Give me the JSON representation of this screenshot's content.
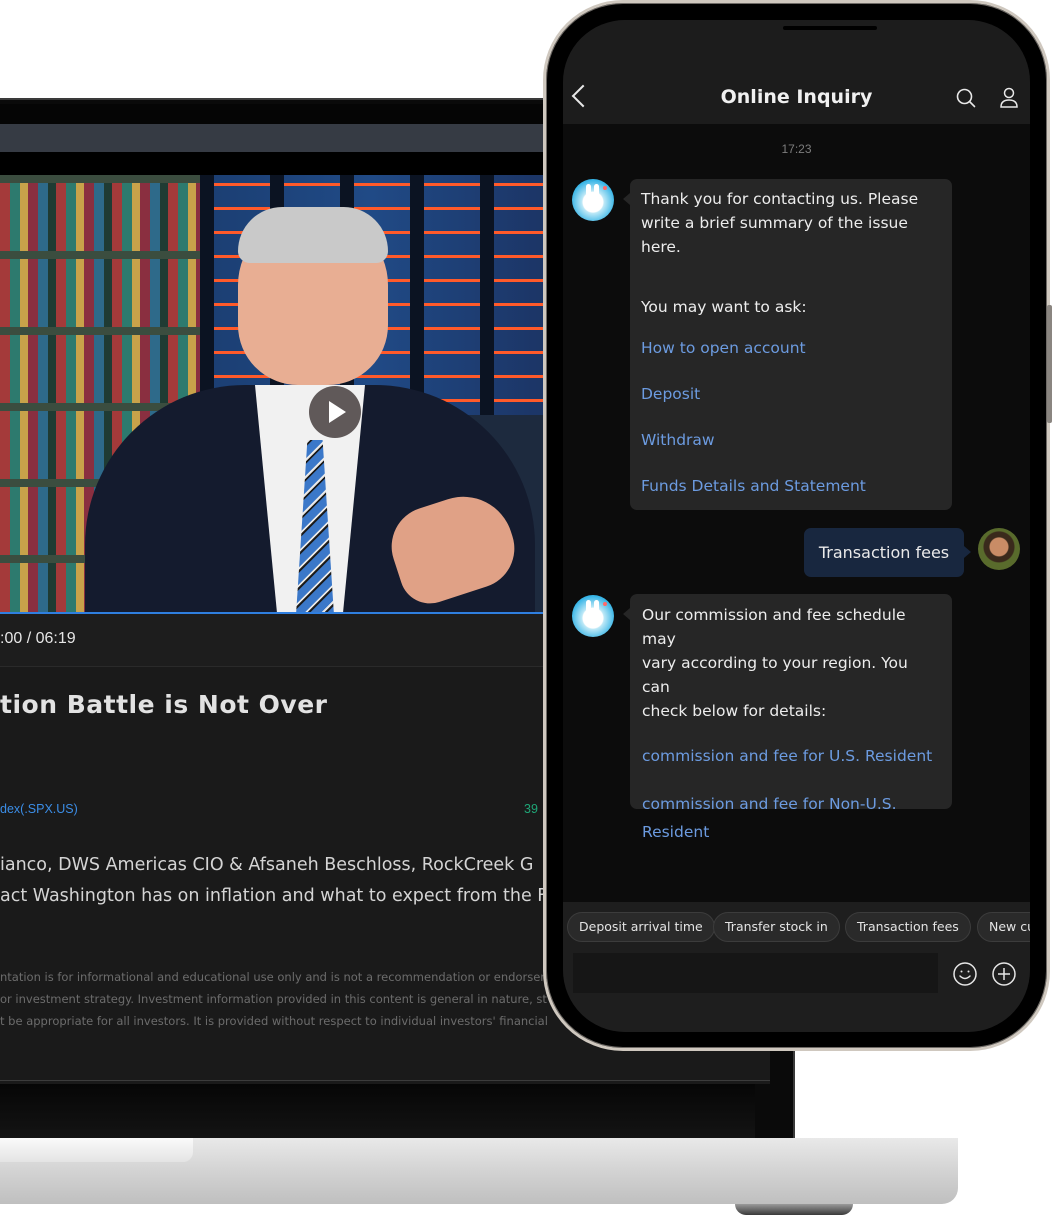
{
  "laptop": {
    "video": {
      "time_display": ":00 / 06:19",
      "play_icon": "play-icon",
      "progress_fraction": 1.0
    },
    "title": "tion Battle is Not Over",
    "ticker_label": "dex(.SPX.US)",
    "ticker_value": "39",
    "description_lines": [
      "ianco, DWS Americas CIO & Afsaneh Beschloss, RockCreek G",
      "act Washington has on inflation and what to expect from the F"
    ],
    "disclaimer_lines": [
      "ntation is for informational and educational use only and is not a recommendation or endorsem",
      " or investment strategy. Investment information provided in this content is general in nature, st",
      "t be appropriate for all investors. It is provided without respect to individual investors' financial"
    ]
  },
  "phone": {
    "header": {
      "title": "Online Inquiry",
      "back_icon": "chevron-left-icon",
      "search_icon": "search-icon",
      "user_icon": "user-icon"
    },
    "timestamp": "17:23",
    "messages": [
      {
        "sender": "bot",
        "text_lines": [
          "Thank you for contacting us. Please",
          "write a brief summary of the issue",
          "here."
        ],
        "prompt": "You may want to ask:",
        "links": [
          "How to open account",
          "Deposit",
          "Withdraw",
          "Funds Details and Statement"
        ]
      },
      {
        "sender": "user",
        "text": "Transaction fees"
      },
      {
        "sender": "bot",
        "text_lines": [
          "Our commission and fee schedule may",
          "vary according to your region. You can",
          "check below for details:"
        ],
        "links": [
          "commission and fee for U.S. Resident",
          "commission and fee for Non-U.S. Resident"
        ]
      }
    ],
    "quick_replies": [
      "Deposit arrival time",
      "Transfer stock in",
      "Transaction fees",
      "New cu"
    ],
    "input": {
      "value": "",
      "placeholder": ""
    },
    "colors": {
      "link": "#6c9be0",
      "user_bubble": "#18273f",
      "bot_bubble": "#262626",
      "progress": "#2f7fe0",
      "ticker": "#3b8de6",
      "ticker_value": "#1fa677"
    }
  }
}
